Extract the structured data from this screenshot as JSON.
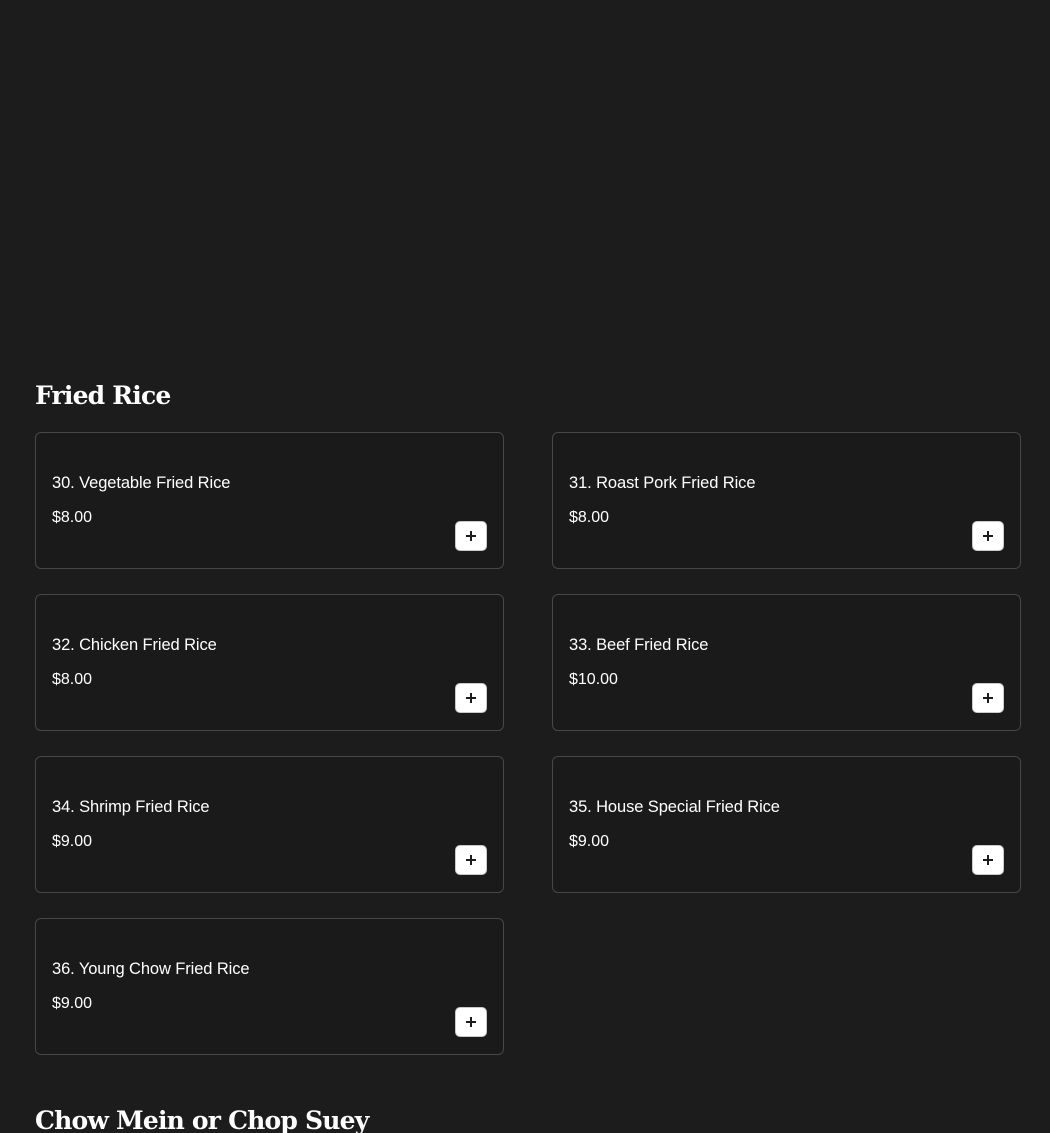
{
  "sections": [
    {
      "title": "Fried Rice",
      "items": [
        {
          "name": "30. Vegetable Fried Rice",
          "price": "$8.00"
        },
        {
          "name": "31. Roast Pork Fried Rice",
          "price": "$8.00"
        },
        {
          "name": "32. Chicken Fried Rice",
          "price": "$8.00"
        },
        {
          "name": "33. Beef Fried Rice",
          "price": "$10.00"
        },
        {
          "name": "34. Shrimp Fried Rice",
          "price": "$9.00"
        },
        {
          "name": "35. House Special Fried Rice",
          "price": "$9.00"
        },
        {
          "name": "36. Young Chow Fried Rice",
          "price": "$9.00"
        }
      ]
    },
    {
      "title": "Chow Mein or Chop Suey"
    }
  ],
  "icons": {
    "add": "plus-icon"
  },
  "colors": {
    "background": "#1c1c1c",
    "card_border": "#474747",
    "text": "#ffffff",
    "button_background": "#ffffff"
  }
}
